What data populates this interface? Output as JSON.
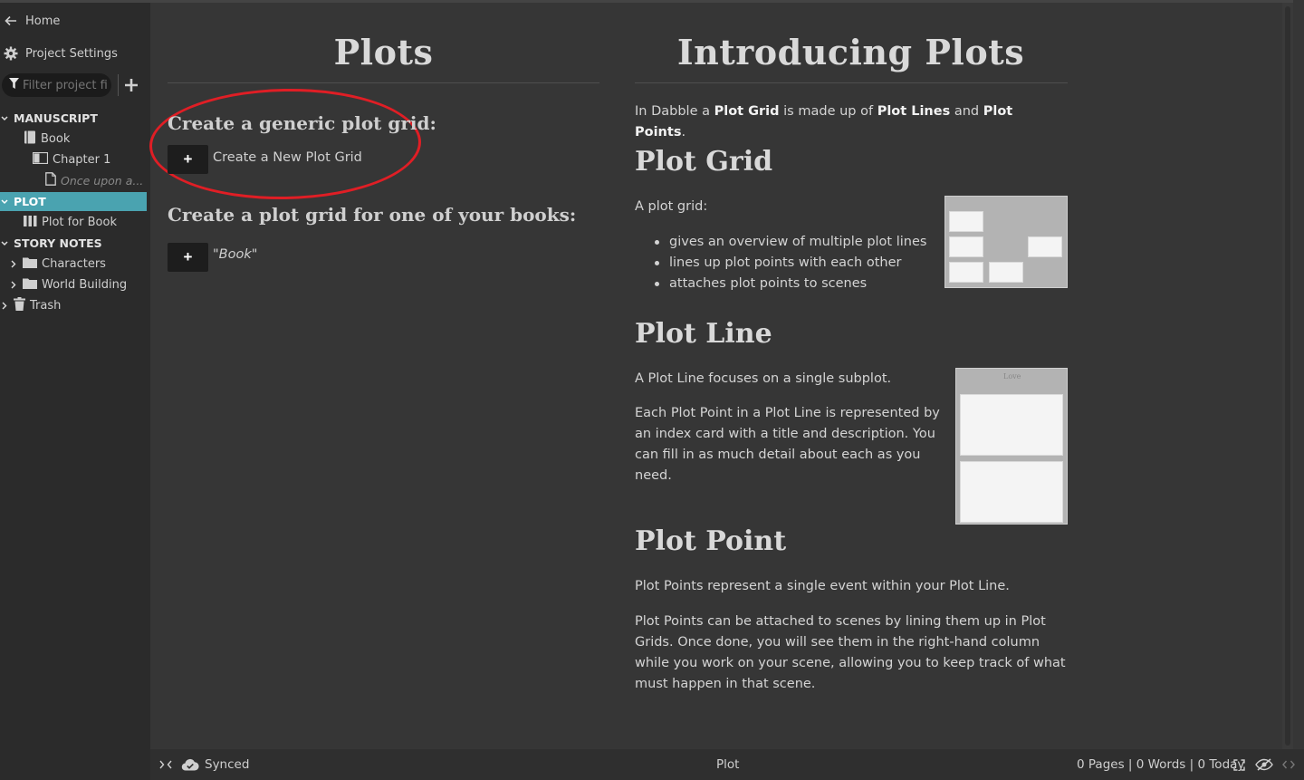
{
  "sidebar": {
    "home_label": "Home",
    "settings_label": "Project Settings",
    "filter_placeholder": "Filter project fil",
    "manuscript": {
      "section_label": "MANUSCRIPT",
      "book_label": "Book",
      "chapter_label": "Chapter 1",
      "scene_label": "Once upon a..."
    },
    "plot": {
      "section_label": "PLOT",
      "item_label": "Plot for Book"
    },
    "story_notes": {
      "section_label": "STORY NOTES",
      "characters_label": "Characters",
      "world_building_label": "World Building"
    },
    "trash_label": "Trash"
  },
  "plots": {
    "title": "Plots",
    "generic_heading": "Create a generic plot grid:",
    "new_grid_button": "+",
    "new_grid_label": "Create a New Plot Grid",
    "book_heading": "Create a plot grid for one of your books:",
    "book_button": "+",
    "book_label": "\"Book\""
  },
  "intro": {
    "title": "Introducing Plots",
    "intro_parts": [
      "In Dabble a ",
      "Plot Grid",
      " is made up of ",
      "Plot Lines",
      " and ",
      "Plot Points",
      "."
    ],
    "plot_grid": {
      "heading": "Plot Grid",
      "lead": "A plot grid:",
      "bullets": [
        "gives an overview of multiple plot lines",
        "lines up plot points with each other",
        "attaches plot points to scenes"
      ]
    },
    "plot_line": {
      "heading": "Plot Line",
      "p1": "A Plot Line focuses on a single subplot.",
      "p2": "Each Plot Point in a Plot Line is represented by an index card with a title and description. You can fill in as much detail about each as you need.",
      "thumb_header": "Love"
    },
    "plot_point": {
      "heading": "Plot Point",
      "p1": "Plot Points represent a single event within your Plot Line.",
      "p2": "Plot Points can be attached to scenes by lining them up in Plot Grids. Once done, you will see them in the right-hand column while you work on your scene, allowing you to keep track of what must happen in that scene."
    }
  },
  "statusbar": {
    "sync_label": "Synced",
    "center_label": "Plot",
    "stats_label": "0 Pages | 0 Words | 0 Today"
  },
  "colors": {
    "accent": "#4aa3b0",
    "annotation": "#e01e25"
  }
}
